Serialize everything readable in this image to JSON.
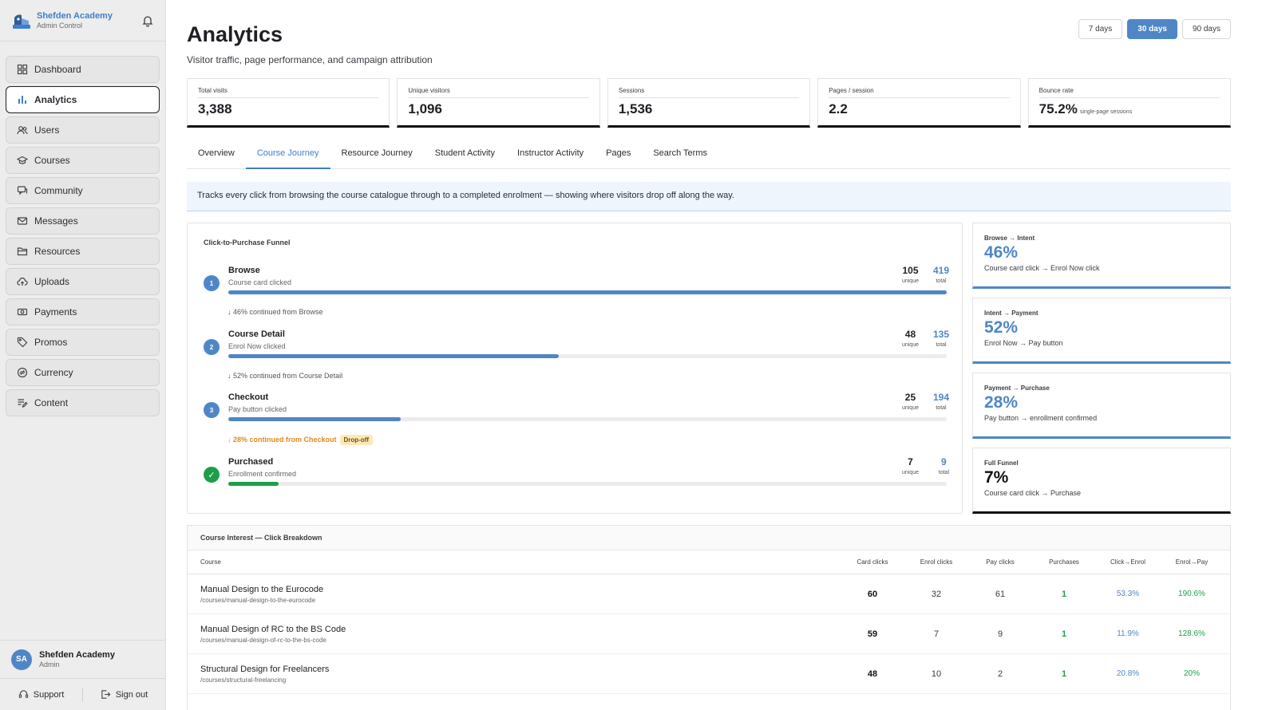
{
  "brand": {
    "name": "Shefden Academy",
    "subtitle": "Admin Control"
  },
  "nav": {
    "items": [
      {
        "label": "Dashboard",
        "icon": "grid-icon"
      },
      {
        "label": "Analytics",
        "icon": "bar-chart-icon",
        "active": true
      },
      {
        "label": "Users",
        "icon": "users-icon"
      },
      {
        "label": "Courses",
        "icon": "graduation-cap-icon"
      },
      {
        "label": "Community",
        "icon": "chat-icon"
      },
      {
        "label": "Messages",
        "icon": "mail-icon"
      },
      {
        "label": "Resources",
        "icon": "folder-icon"
      },
      {
        "label": "Uploads",
        "icon": "cloud-upload-icon"
      },
      {
        "label": "Payments",
        "icon": "money-icon"
      },
      {
        "label": "Promos",
        "icon": "tag-icon"
      },
      {
        "label": "Currency",
        "icon": "exchange-icon"
      },
      {
        "label": "Content",
        "icon": "edit-list-icon"
      }
    ]
  },
  "user": {
    "initials": "SA",
    "name": "Shefden Academy",
    "role": "Admin"
  },
  "footer": {
    "support": "Support",
    "signout": "Sign out"
  },
  "header": {
    "title": "Analytics",
    "subtitle": "Visitor traffic, page performance, and campaign attribution"
  },
  "range": {
    "options": [
      "7 days",
      "30 days",
      "90 days"
    ],
    "selected": "30 days"
  },
  "stats": [
    {
      "label": "Total visits",
      "value": "3,388"
    },
    {
      "label": "Unique visitors",
      "value": "1,096"
    },
    {
      "label": "Sessions",
      "value": "1,536"
    },
    {
      "label": "Pages / session",
      "value": "2.2"
    },
    {
      "label": "Bounce rate",
      "value": "75.2%",
      "note": "single-page sessions"
    }
  ],
  "tabs": [
    "Overview",
    "Course Journey",
    "Resource Journey",
    "Student Activity",
    "Instructor Activity",
    "Pages",
    "Search Terms"
  ],
  "active_tab": "Course Journey",
  "notice": "Tracks every click from browsing the course catalogue through to a completed enrolment — showing where visitors drop off along the way.",
  "funnel": {
    "title": "Click-to-Purchase Funnel",
    "unique_label": "unique",
    "total_label": "total",
    "steps": [
      {
        "num": "1",
        "name": "Browse",
        "desc": "Course card clicked",
        "unique": "105",
        "total": "419",
        "fill_pct": 100
      },
      {
        "num": "2",
        "name": "Course Detail",
        "desc": "Enrol Now clicked",
        "unique": "48",
        "total": "135",
        "fill_pct": 46
      },
      {
        "num": "3",
        "name": "Checkout",
        "desc": "Pay button clicked",
        "unique": "25",
        "total": "194",
        "fill_pct": 24
      },
      {
        "num": "✓",
        "name": "Purchased",
        "desc": "Enrollment confirmed",
        "unique": "7",
        "total": "9",
        "fill_pct": 7
      }
    ],
    "continued": [
      {
        "text": "↓  46% continued from Browse",
        "drop": false
      },
      {
        "text": "↓  52% continued from Course Detail",
        "drop": false
      },
      {
        "text": "↓  28% continued from Checkout",
        "drop": true,
        "badge": "Drop-off"
      }
    ]
  },
  "conversions": [
    {
      "label": "Browse → Intent",
      "value": "46%",
      "desc": "Course card click → Enrol Now click"
    },
    {
      "label": "Intent → Payment",
      "value": "52%",
      "desc": "Enrol Now → Pay button"
    },
    {
      "label": "Payment → Purchase",
      "value": "28%",
      "desc": "Pay button → enrollment confirmed"
    },
    {
      "label": "Full Funnel",
      "value": "7%",
      "desc": "Course card click → Purchase"
    }
  ],
  "table": {
    "title": "Course Interest — Click Breakdown",
    "headers": [
      "Course",
      "Card clicks",
      "Enrol clicks",
      "Pay clicks",
      "Purchases",
      "Click→Enrol",
      "Enrol→Pay"
    ],
    "rows": [
      {
        "name": "Manual Design to the Eurocode",
        "path": "/courses/manual-design-to-the-eurocode",
        "card": "60",
        "enrol": "32",
        "pay": "61",
        "purchases": "1",
        "click_enrol": "53.3%",
        "enrol_pay": "190.6%"
      },
      {
        "name": "Manual Design of RC to the BS Code",
        "path": "/courses/manual-design-of-rc-to-the-bs-code",
        "card": "59",
        "enrol": "7",
        "pay": "9",
        "purchases": "1",
        "click_enrol": "11.9%",
        "enrol_pay": "128.6%"
      },
      {
        "name": "Structural Design for Freelancers",
        "path": "/courses/structural-freelancing",
        "card": "48",
        "enrol": "10",
        "pay": "2",
        "purchases": "1",
        "click_enrol": "20.8%",
        "enrol_pay": "20%"
      }
    ]
  },
  "colors": {
    "accent": "#4f86c6",
    "success": "#1f9d49",
    "warning": "#e08a1e"
  }
}
